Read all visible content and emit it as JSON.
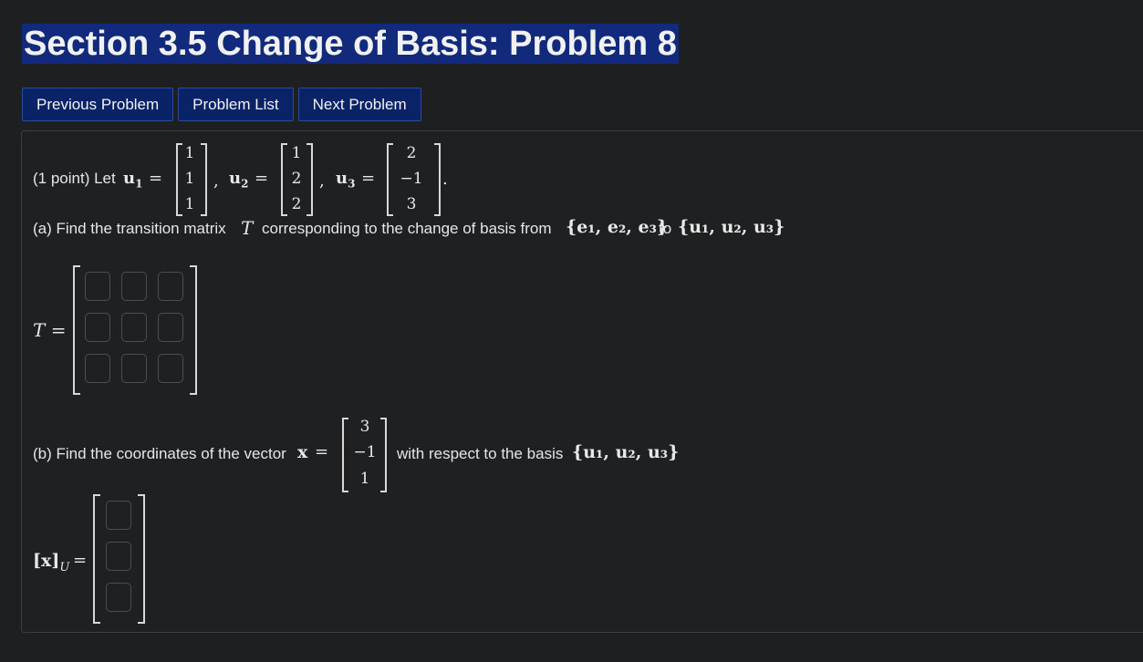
{
  "page": {
    "title": "Section 3.5 Change of Basis: Problem 8"
  },
  "nav": {
    "previous": "Previous Problem",
    "list": "Problem List",
    "next": "Next Problem"
  },
  "problem": {
    "intro": "(1 point) Let",
    "u1_label": "u",
    "u1_sub": "1",
    "u2_label": "u",
    "u2_sub": "2",
    "u3_label": "u",
    "u3_sub": "3",
    "eq": "=",
    "comma": ",",
    "period": ".",
    "u1": [
      "1",
      "1",
      "1"
    ],
    "u2": [
      "1",
      "2",
      "2"
    ],
    "u3": [
      "2",
      "−1",
      "3"
    ],
    "part_a_text": "(a) Find the transition matrix",
    "part_a_T": "T",
    "part_a_mid": "corresponding to the change of basis from",
    "part_a_set_e": "{e₁, e₂, e₃}",
    "part_a_to": "to",
    "part_a_set_u": "{u₁, u₂, u₃}",
    "T_label": "T =",
    "part_b_text": "(b) Find the coordinates of the vector",
    "x_label": "x",
    "x": [
      "3",
      "−1",
      "1"
    ],
    "part_b_after": "with respect to the basis",
    "part_b_set_u": "{u₁, u₂, u₃}",
    "xU_label": "[x]",
    "xU_sub": "U",
    "xU_eq": "="
  }
}
